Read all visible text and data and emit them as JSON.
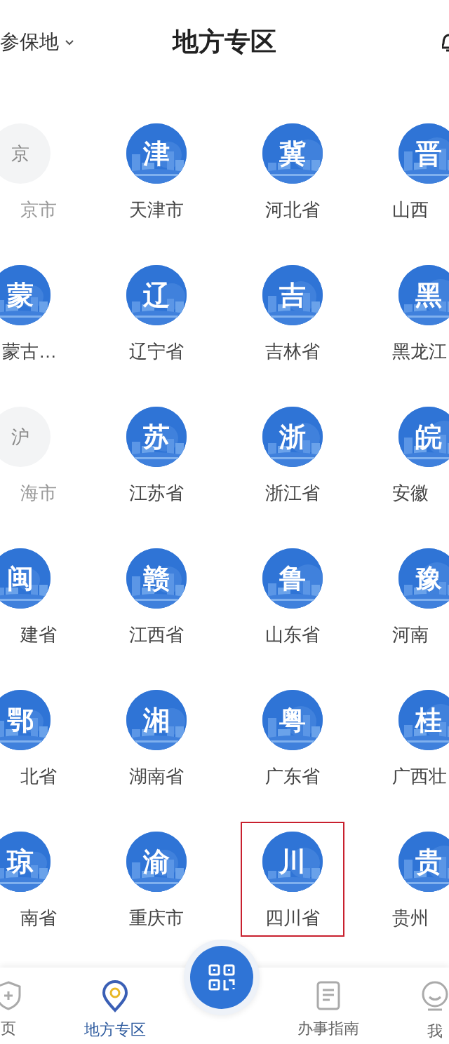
{
  "header": {
    "location_label": "参保地",
    "title": "地方专区"
  },
  "provinces": [
    {
      "glyph": "京",
      "label": "京市",
      "disabled": true,
      "highlighted": false
    },
    {
      "glyph": "津",
      "label": "天津市",
      "disabled": false,
      "highlighted": false
    },
    {
      "glyph": "冀",
      "label": "河北省",
      "disabled": false,
      "highlighted": false
    },
    {
      "glyph": "晋",
      "label": "山西",
      "disabled": false,
      "highlighted": false
    },
    {
      "glyph": "蒙",
      "label": "蒙古…",
      "disabled": false,
      "highlighted": false
    },
    {
      "glyph": "辽",
      "label": "辽宁省",
      "disabled": false,
      "highlighted": false
    },
    {
      "glyph": "吉",
      "label": "吉林省",
      "disabled": false,
      "highlighted": false
    },
    {
      "glyph": "黑",
      "label": "黑龙江",
      "disabled": false,
      "highlighted": false
    },
    {
      "glyph": "沪",
      "label": "海市",
      "disabled": true,
      "highlighted": false
    },
    {
      "glyph": "苏",
      "label": "江苏省",
      "disabled": false,
      "highlighted": false
    },
    {
      "glyph": "浙",
      "label": "浙江省",
      "disabled": false,
      "highlighted": false
    },
    {
      "glyph": "皖",
      "label": "安徽",
      "disabled": false,
      "highlighted": false
    },
    {
      "glyph": "闽",
      "label": "建省",
      "disabled": false,
      "highlighted": false
    },
    {
      "glyph": "赣",
      "label": "江西省",
      "disabled": false,
      "highlighted": false
    },
    {
      "glyph": "鲁",
      "label": "山东省",
      "disabled": false,
      "highlighted": false
    },
    {
      "glyph": "豫",
      "label": "河南",
      "disabled": false,
      "highlighted": false
    },
    {
      "glyph": "鄂",
      "label": "北省",
      "disabled": false,
      "highlighted": false
    },
    {
      "glyph": "湘",
      "label": "湖南省",
      "disabled": false,
      "highlighted": false
    },
    {
      "glyph": "粤",
      "label": "广东省",
      "disabled": false,
      "highlighted": false
    },
    {
      "glyph": "桂",
      "label": "广西壮",
      "disabled": false,
      "highlighted": false
    },
    {
      "glyph": "琼",
      "label": "南省",
      "disabled": false,
      "highlighted": false
    },
    {
      "glyph": "渝",
      "label": "重庆市",
      "disabled": false,
      "highlighted": false
    },
    {
      "glyph": "川",
      "label": "四川省",
      "disabled": false,
      "highlighted": true
    },
    {
      "glyph": "贵",
      "label": "贵州",
      "disabled": false,
      "highlighted": false
    }
  ],
  "nav": {
    "items": [
      {
        "label": "页",
        "selected": false
      },
      {
        "label": "地方专区",
        "selected": true
      },
      {
        "label": "办事指南",
        "selected": false
      },
      {
        "label": "我",
        "selected": false
      }
    ]
  }
}
